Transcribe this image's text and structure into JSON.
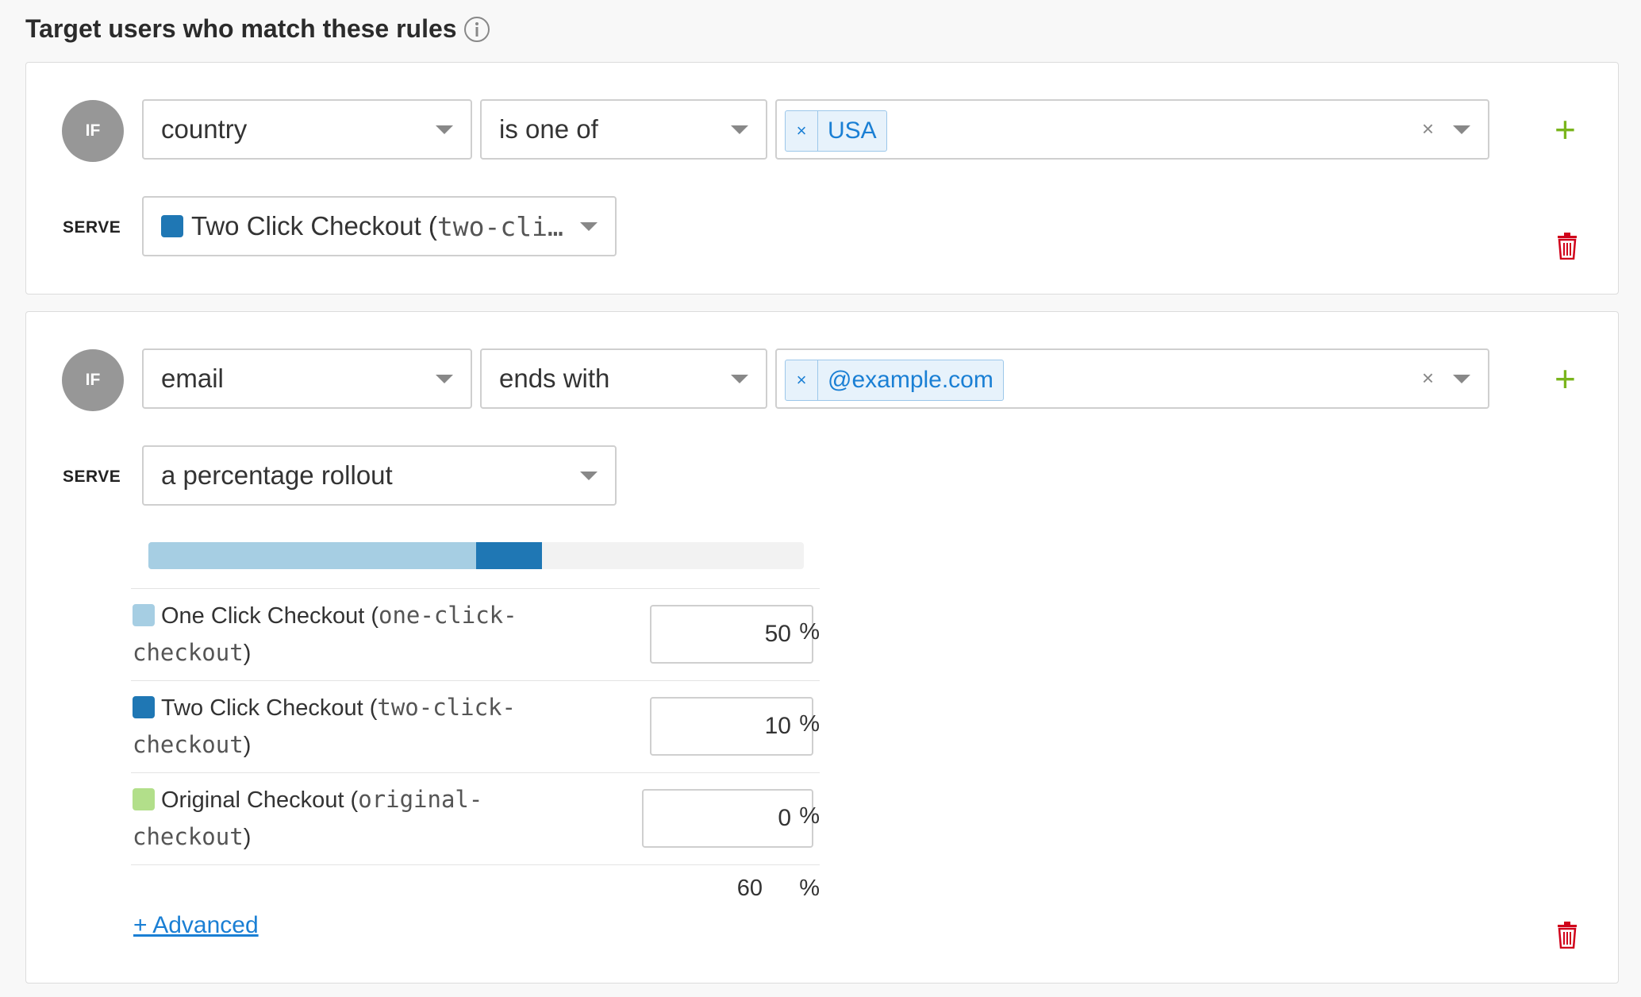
{
  "header": {
    "title": "Target users who match these rules",
    "info_icon": "info-icon"
  },
  "rules": [
    {
      "if_label": "IF",
      "attribute": "country",
      "operator": "is one of",
      "values": [
        "USA"
      ],
      "serve_label": "SERVE",
      "serve": {
        "name": "Two Click Checkout (",
        "key": "two-cli…",
        "color": "#1f77b4"
      }
    },
    {
      "if_label": "IF",
      "attribute": "email",
      "operator": "ends with",
      "values": [
        "@example.com"
      ],
      "serve_label": "SERVE",
      "serve": {
        "name": "a percentage rollout"
      },
      "rollout": {
        "variations": [
          {
            "name": "One Click Checkout (",
            "key_part1": "one-click-",
            "key_part2": "checkout",
            "close": ")",
            "percent": "50",
            "color": "#a6cee3"
          },
          {
            "name": "Two Click Checkout (",
            "key_part1": "two-click-",
            "key_part2": "checkout",
            "close": ")",
            "percent": "10",
            "color": "#1f77b4"
          },
          {
            "name": "Original Checkout (",
            "key_part1": "original-",
            "key_part2": "checkout",
            "close": ")",
            "percent": "0",
            "color": "#b2df8a"
          }
        ],
        "percent_sign": "%",
        "total": "60",
        "advanced_link": "+ Advanced"
      }
    }
  ],
  "colors": {
    "accent_blue": "#1a7fd4",
    "add_green": "#7ab51d",
    "delete_red": "#d0021b"
  }
}
